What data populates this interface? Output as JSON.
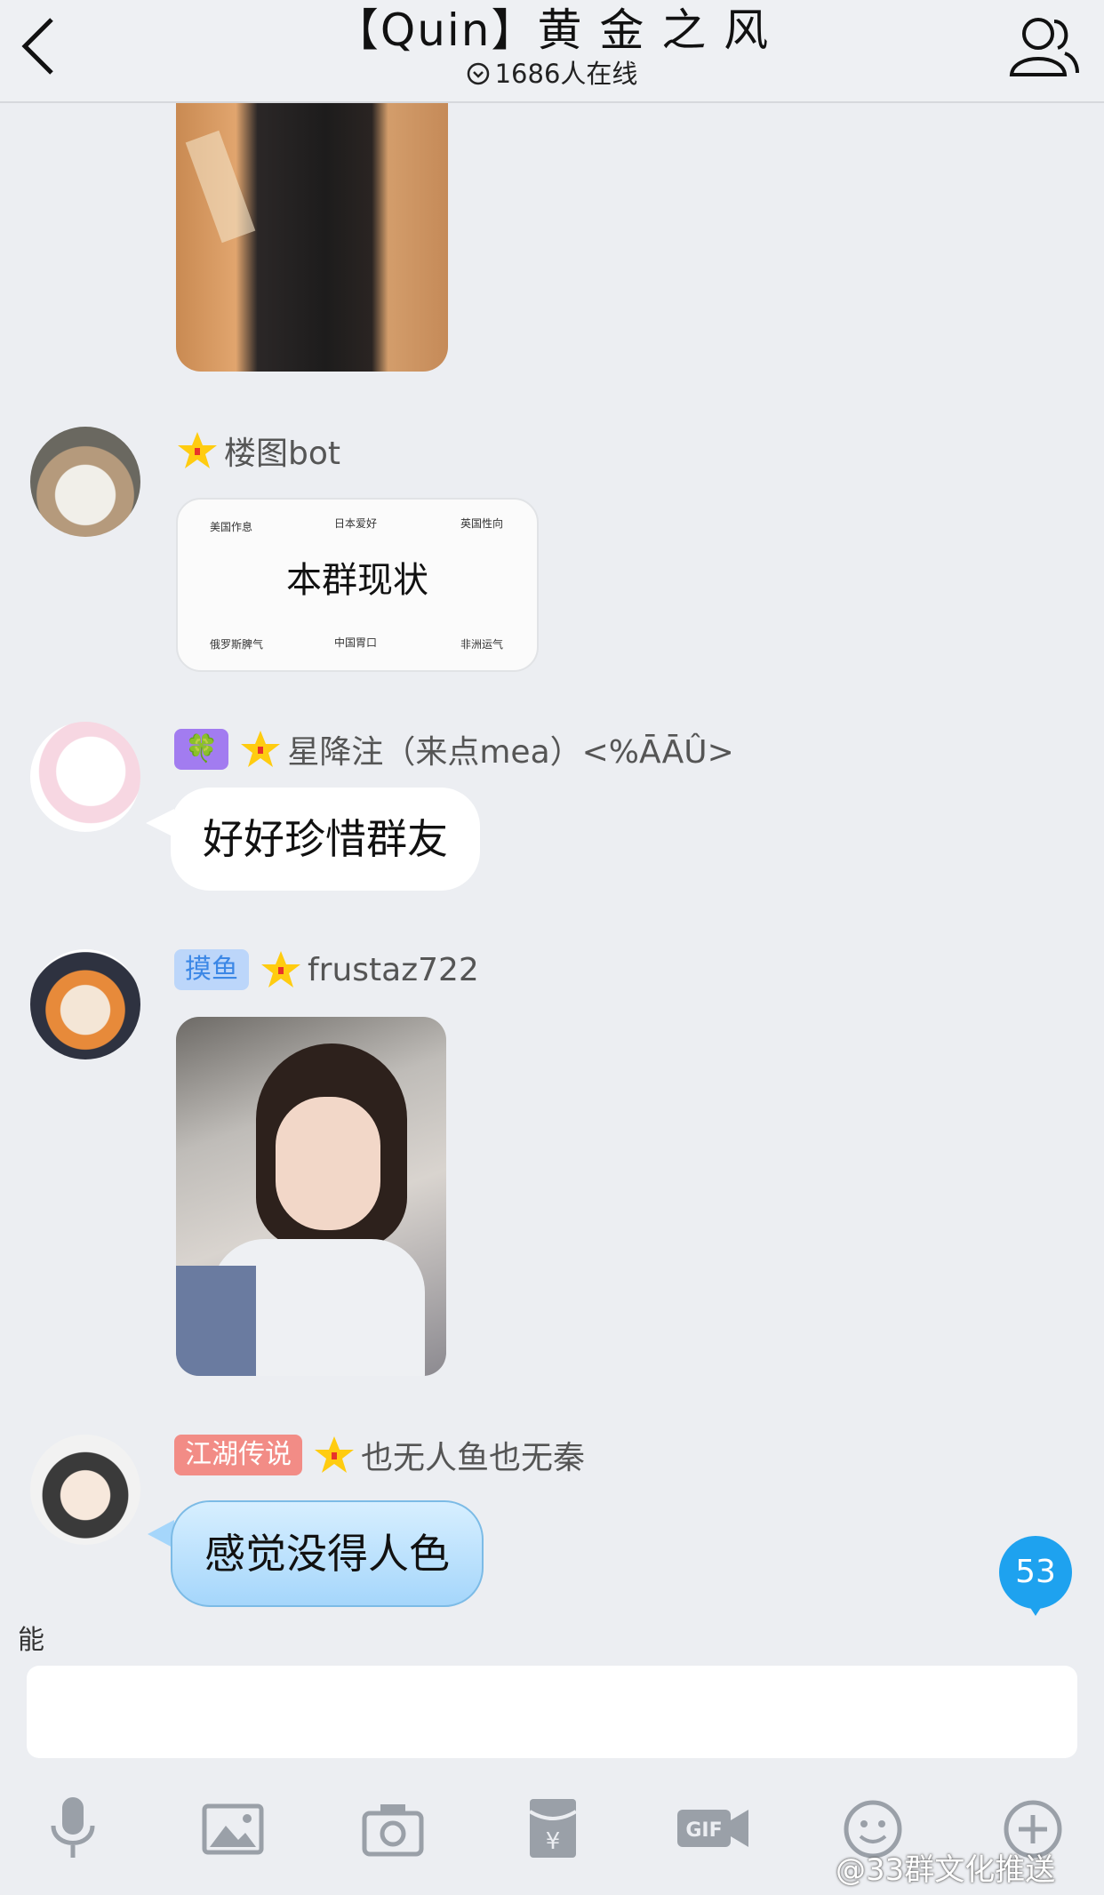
{
  "header": {
    "title": "【Quin】黄 金 之 风",
    "online": "1686人在线"
  },
  "messages": [
    {
      "sender": "楼图bot",
      "card": {
        "center": "本群现状",
        "labels": [
          "美国作息",
          "日本爱好",
          "英国性向",
          "俄罗斯脾气",
          "中国胃口",
          "非洲运气"
        ]
      }
    },
    {
      "tag": "🍀",
      "sender": "星降注（来点mea）<%ĀĀÛ>",
      "text": "好好珍惜群友"
    },
    {
      "tag": "摸鱼",
      "sender": "frustaz722"
    },
    {
      "tag": "江湖传说",
      "sender": "也无人鱼也无秦",
      "text": "感觉没得人色"
    }
  ],
  "unread_badge": "53",
  "input": {
    "typed_char": "能"
  },
  "toolbar": [
    "mic-icon",
    "image-icon",
    "camera-icon",
    "red-packet-icon",
    "gif-icon",
    "emoji-icon",
    "plus-icon"
  ],
  "watermark": "@33群文化推送"
}
